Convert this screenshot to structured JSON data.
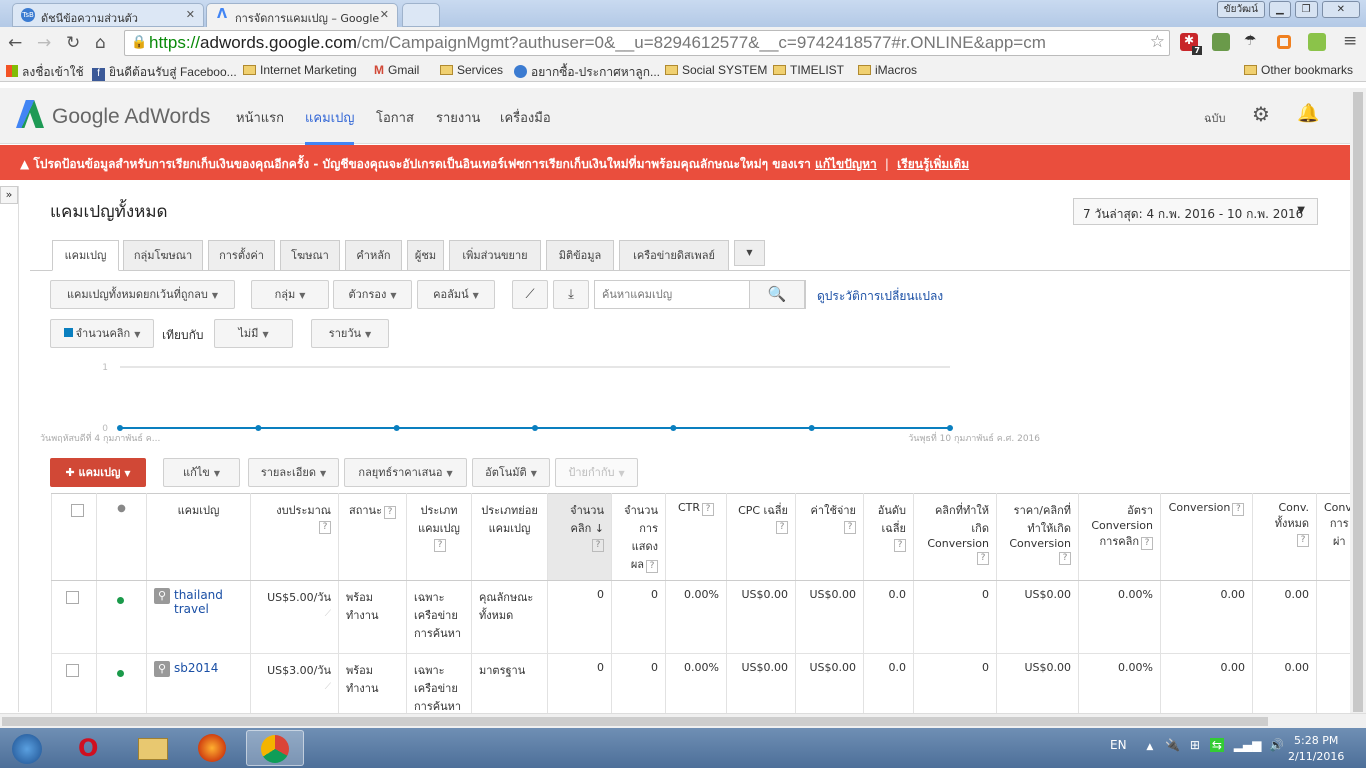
{
  "browser": {
    "tabs": [
      {
        "title": "ดัชนีข้อความส่วนตัว",
        "active": false
      },
      {
        "title": "การจัดการแคมเปญ – Google",
        "active": true
      }
    ],
    "profile_button": "ขัยวัฒน์",
    "url_scheme": "https://",
    "url_domain": "adwords.google.com",
    "url_path": "/cm/CampaignMgmt?authuser=0&__u=8294612577&__c=9742418577#r.ONLINE&app=cm",
    "extension_badge": "7",
    "bookmarks": [
      "ลงชื่อเข้าใช้",
      "ยินดีต้อนรับสู่ Faceboo...",
      "Internet Marketing",
      "Gmail",
      "Services",
      "อยากซื้อ-ประกาศหาลูก...",
      "Social SYSTEM",
      "TIMELIST",
      "iMacros"
    ],
    "other_bookmarks": "Other bookmarks"
  },
  "header": {
    "logo": "Google AdWords",
    "nav": [
      "หน้าแรก",
      "แคมเปญ",
      "โอกาส",
      "รายงาน",
      "เครื่องมือ"
    ],
    "active_nav": 1,
    "account": "ฉบับ"
  },
  "banner": {
    "message": "โปรดป้อนข้อมูลสำหรับการเรียกเก็บเงินของคุณอีกครั้ง - บัญชีของคุณจะอัปเกรดเป็นอินเทอร์เฟซการเรียกเก็บเงินใหม่ที่มาพร้อมคุณลักษณะใหม่ๆ ของเรา",
    "fix_link": "แก้ไขปัญหา",
    "separator": "|",
    "learn_link": "เรียนรู้เพิ่มเติม",
    "color": "#ea4e3d"
  },
  "page": {
    "title": "แคมเปญทั้งหมด",
    "date_range": "7 วันล่าสุด: 4 ก.พ. 2016 - 10 ก.พ. 2016"
  },
  "tabs": [
    "แคมเปญ",
    "กลุ่มโฆษณา",
    "การตั้งค่า",
    "โฆษณา",
    "คำหลัก",
    "ผู้ชม",
    "เพิ่มส่วนขยาย",
    "มิติข้อมูล",
    "เครือข่ายดิสเพลย์"
  ],
  "toolbar": {
    "filter_all": "แคมเปญทั้งหมดยกเว้นที่ถูกลบ",
    "segment": "กลุ่ม",
    "filter": "ตัวกรอง",
    "columns": "คอลัมน์",
    "search_placeholder": "ค้นหาแคมเปญ",
    "history_link": "ดูประวัติการเปลี่ยนแปลง"
  },
  "chart_controls": {
    "metric": "จำนวนคลิก",
    "compare_label": "เทียบกับ",
    "compare": "ไม่มี",
    "period": "รายวัน",
    "metric_color": "#0a7fbf"
  },
  "chart_data": {
    "type": "line",
    "x": [
      "2016-02-04",
      "2016-02-05",
      "2016-02-06",
      "2016-02-07",
      "2016-02-08",
      "2016-02-09",
      "2016-02-10"
    ],
    "series": [
      {
        "name": "จำนวนคลิก",
        "values": [
          0,
          0,
          0,
          0,
          0,
          0,
          0
        ]
      }
    ],
    "ylim": [
      0,
      1
    ],
    "yticks": [
      "0",
      "1"
    ],
    "x_start_label": "วันพฤหัสบดีที่ 4 กุมภาพันธ์ ค...",
    "x_end_label": "วันพุธที่ 10 กุมภาพันธ์ ค.ศ. 2016",
    "grid": true
  },
  "actions": {
    "add": "แคมเปญ",
    "edit": "แก้ไข",
    "details": "รายละเอียด",
    "bid_strategy": "กลยุทธ์ราคาเสนอ",
    "automate": "อัตโนมัติ",
    "labels": "ป้ายกำกับ"
  },
  "table": {
    "headers": [
      "แคมเปญ",
      "งบประมาณ",
      "สถานะ",
      "ประเภทแคมเปญ",
      "ประเภทย่อยแคมเปญ",
      "จำนวนคลิก",
      "จำนวนการแสดงผล",
      "CTR",
      "CPC เฉลี่ย",
      "ค่าใช้จ่าย",
      "อันดับเฉลี่ย",
      "คลิกที่ทำให้เกิด Conversion",
      "ราคา/คลิกที่ทำให้เกิด Conversion",
      "อัตรา Conversion การคลิก",
      "Conversion",
      "Conv. ทั้งหมด",
      "Conv. การ ผ่า"
    ],
    "rows": [
      {
        "name": "thailand travel",
        "budget": "US$5.00/วัน",
        "status": "พร้อมทำงาน",
        "type": "เฉพาะเครือข่ายการค้นหา",
        "subtype": "คุณลักษณะทั้งหมด",
        "clicks": "0",
        "impr": "0",
        "ctr": "0.00%",
        "cpc": "US$0.00",
        "cost": "US$0.00",
        "pos": "0.0",
        "conv_clicks": "0",
        "cost_conv": "US$0.00",
        "conv_rate": "0.00%",
        "conversions": "0.00",
        "all_conv": "0.00"
      },
      {
        "name": "sb2014",
        "budget": "US$3.00/วัน",
        "status": "พร้อมทำงาน",
        "type": "เฉพาะเครือข่ายการค้นหา",
        "subtype": "มาตรฐาน",
        "clicks": "0",
        "impr": "0",
        "ctr": "0.00%",
        "cpc": "US$0.00",
        "cost": "US$0.00",
        "pos": "0.0",
        "conv_clicks": "0",
        "cost_conv": "US$0.00",
        "conv_rate": "0.00%",
        "conversions": "0.00",
        "all_conv": "0.00"
      }
    ]
  },
  "taskbar": {
    "lang": "EN",
    "time": "5:28 PM",
    "date": "2/11/2016"
  }
}
